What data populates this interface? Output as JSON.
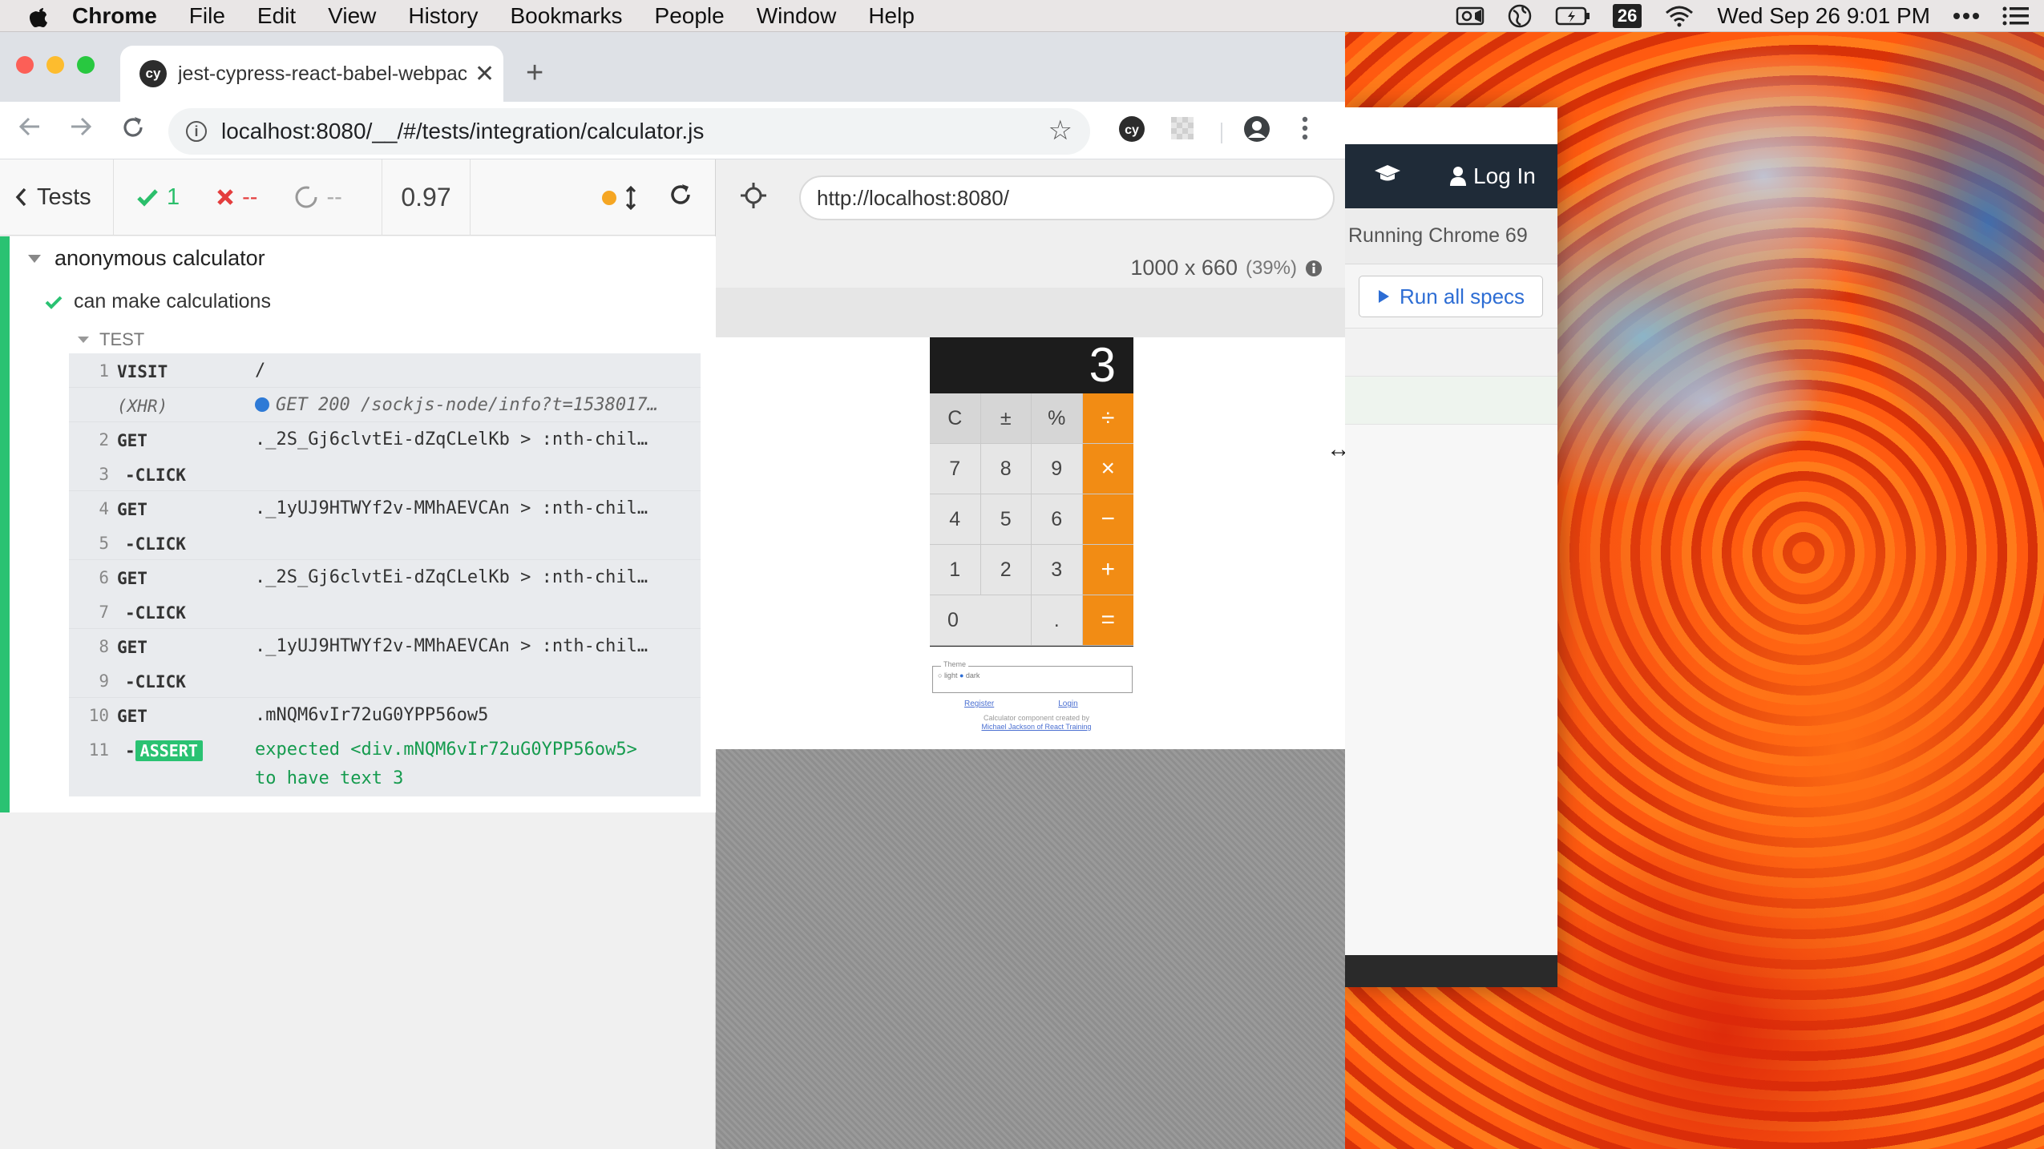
{
  "menubar": {
    "app_name": "Chrome",
    "items": [
      "File",
      "Edit",
      "View",
      "History",
      "Bookmarks",
      "People",
      "Window",
      "Help"
    ],
    "badge": "26",
    "clock": "Wed Sep 26  9:01 PM"
  },
  "browser": {
    "tab_title": "jest-cypress-react-babel-webpack",
    "favicon_text": "cy",
    "url": "localhost:8080/__/#/tests/integration/calculator.js"
  },
  "reporter": {
    "tests_label": "Tests",
    "passed": "1",
    "failed": "--",
    "pending": "--",
    "duration": "0.97",
    "suite_title": "anonymous calculator",
    "test_title": "can make calculations",
    "section_label": "TEST",
    "commands": [
      {
        "num": "1",
        "name": "VISIT",
        "message": "/"
      },
      {
        "num": "",
        "name": "(XHR)",
        "message": "GET 200 /sockjs-node/info?t=1538017…"
      },
      {
        "num": "2",
        "name": "GET",
        "message": "._2S_Gj6clvtEi-dZqCLelKb > :nth-chil…"
      },
      {
        "num": "3",
        "name": "-CLICK",
        "message": ""
      },
      {
        "num": "4",
        "name": "GET",
        "message": "._1yUJ9HTWYf2v-MMhAEVCAn > :nth-chil…"
      },
      {
        "num": "5",
        "name": "-CLICK",
        "message": ""
      },
      {
        "num": "6",
        "name": "GET",
        "message": "._2S_Gj6clvtEi-dZqCLelKb > :nth-chil…"
      },
      {
        "num": "7",
        "name": "-CLICK",
        "message": ""
      },
      {
        "num": "8",
        "name": "GET",
        "message": "._1yUJ9HTWYf2v-MMhAEVCAn > :nth-chil…"
      },
      {
        "num": "9",
        "name": "-CLICK",
        "message": ""
      },
      {
        "num": "10",
        "name": "GET",
        "message": ".mNQM6vIr72uG0YPP56ow5"
      },
      {
        "num": "11",
        "name": "ASSERT",
        "message_line1": "expected <div.mNQM6vIr72uG0YPP56ow5>",
        "message_line2": "to have text 3"
      }
    ]
  },
  "aut": {
    "url": "http://localhost:8080/",
    "viewport_size": "1000 x 660",
    "viewport_pct": "(39%)",
    "calculator": {
      "display": "3",
      "keys": [
        {
          "label": "C",
          "kind": "fn"
        },
        {
          "label": "±",
          "kind": "fn"
        },
        {
          "label": "%",
          "kind": "fn"
        },
        {
          "label": "÷",
          "kind": "op"
        },
        {
          "label": "7",
          "kind": "num"
        },
        {
          "label": "8",
          "kind": "num"
        },
        {
          "label": "9",
          "kind": "num"
        },
        {
          "label": "×",
          "kind": "op"
        },
        {
          "label": "4",
          "kind": "num"
        },
        {
          "label": "5",
          "kind": "num"
        },
        {
          "label": "6",
          "kind": "num"
        },
        {
          "label": "−",
          "kind": "op"
        },
        {
          "label": "1",
          "kind": "num"
        },
        {
          "label": "2",
          "kind": "num"
        },
        {
          "label": "3",
          "kind": "num"
        },
        {
          "label": "+",
          "kind": "op"
        },
        {
          "label": "0",
          "kind": "zero"
        },
        {
          "label": ".",
          "kind": "num"
        },
        {
          "label": "=",
          "kind": "op"
        }
      ]
    },
    "theme_legend": "Theme",
    "theme_light": "light",
    "theme_dark": "dark",
    "register_link": "Register",
    "login_link": "Login",
    "credit_line1": "Calculator component created by",
    "credit_line2": "Michael Jackson of React Training"
  },
  "cypress_app": {
    "login_label": "Log In",
    "running_text": "Running Chrome 69",
    "run_all_label": "Run all specs"
  },
  "colors": {
    "pass": "#2ac272",
    "fail": "#e43e3e",
    "operator": "#f28c14",
    "link_blue": "#2d6dd4"
  }
}
